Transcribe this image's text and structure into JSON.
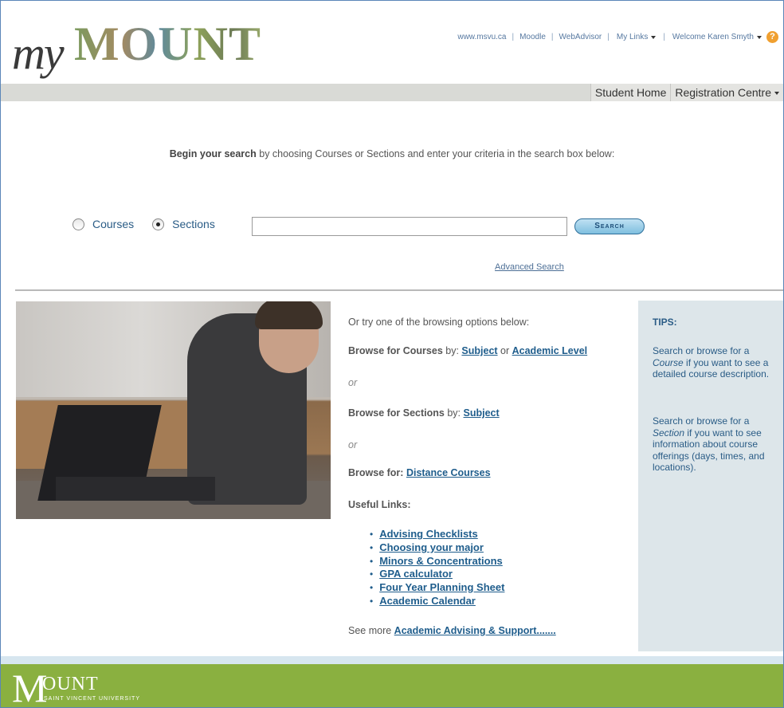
{
  "brand": {
    "my": "my",
    "mount": "MOUNT"
  },
  "toplinks": {
    "msvu": "www.msvu.ca",
    "moodle": "Moodle",
    "webadvisor": "WebAdvisor",
    "mylinks": "My Links",
    "welcome": "Welcome Karen Smyth",
    "help_icon": "help-icon"
  },
  "nav": {
    "tabs": [
      "Student Home",
      "Registration Centre"
    ]
  },
  "search": {
    "intro_bold": "Begin your search",
    "intro_rest": " by choosing Courses or Sections and enter your criteria in the search box below:",
    "radio_courses": "Courses",
    "radio_sections": "Sections",
    "selected": "Sections",
    "input_value": "",
    "button": "Search",
    "advanced": "Advanced Search"
  },
  "browse": {
    "intro": "Or try one of the browsing options below:",
    "courses_prefix": "Browse for Courses",
    "courses_by": " by: ",
    "subject": "Subject",
    "or_word": " or ",
    "academic_level": "Academic Level",
    "or1": "or",
    "sections_prefix": "Browse for Sections",
    "sections_by": " by: ",
    "sections_subject": "Subject",
    "or2": "or",
    "browse_for": "Browse for: ",
    "distance": "Distance Courses",
    "useful_links": "Useful Links:",
    "links": [
      "Advising Checklists",
      "Choosing your major",
      "Minors & Concentrations",
      "GPA calculator",
      "Four Year Planning Sheet",
      "Academic Calendar"
    ],
    "see_more": "See more ",
    "advising_support": "Academic Advising & Support......."
  },
  "tips": {
    "title": "TIPS:",
    "tip1_a": "Search or browse for a ",
    "tip1_em": "Course",
    "tip1_b": " if you want to see a detailed course description.",
    "tip2_a": "Search or browse for a ",
    "tip2_em": "Section",
    "tip2_b": " if you want to see information about course offerings (days, times, and locations)."
  },
  "footer": {
    "m": "M",
    "ount": "OUNT",
    "sub": "SAINT VINCENT UNIVERSITY"
  },
  "colors": {
    "accent": "#2a5c86",
    "footer_green": "#8ab040",
    "tips_bg": "#dde6ea"
  }
}
